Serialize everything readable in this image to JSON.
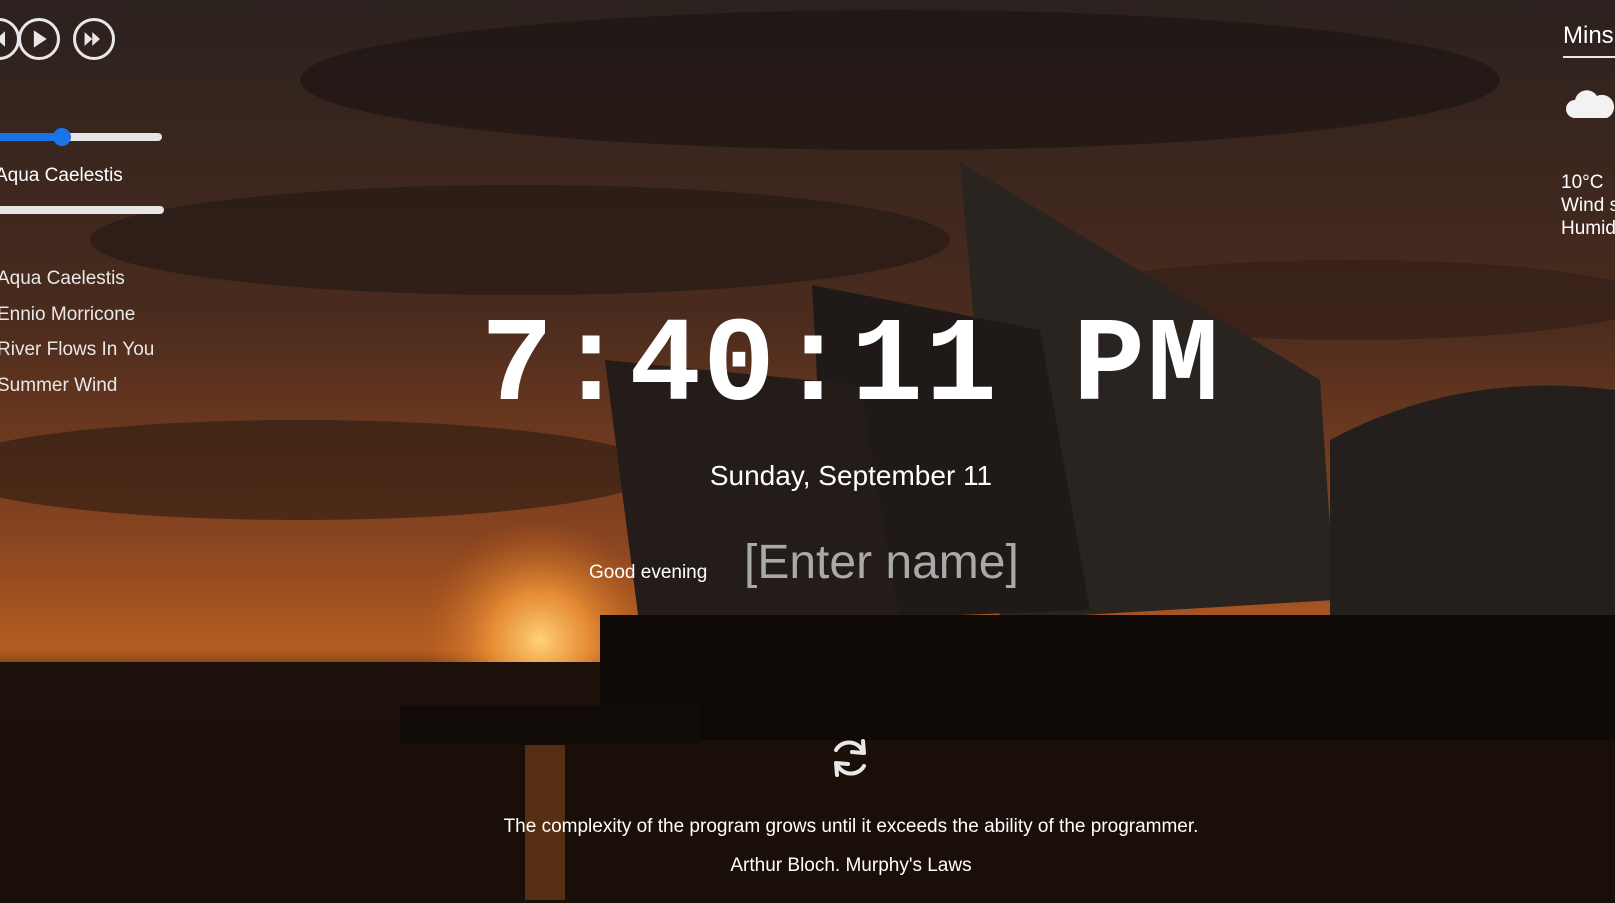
{
  "player": {
    "track_title": "Aqua Caelestis",
    "volume_fraction": 0.4,
    "progress_fraction": 0,
    "playlist": [
      "Aqua Caelestis",
      "Ennio Morricone",
      "River Flows In You",
      "Summer Wind"
    ]
  },
  "clock": {
    "time": "7:40:11 PM",
    "date": "Sunday, September 11"
  },
  "greeting": {
    "text": "Good evening",
    "name_placeholder": "[Enter name]"
  },
  "quote": {
    "text": "The complexity of the program grows until it exceeds the ability of the programmer.",
    "author": "Arthur Bloch. Murphy's Laws"
  },
  "weather": {
    "city": "Minsk",
    "temperature": "10°C",
    "wind": "Wind speed",
    "humidity": "Humidity"
  },
  "colors": {
    "accent": "#1a73e8",
    "text": "#ffffff",
    "placeholder": "#a9a9a9"
  }
}
